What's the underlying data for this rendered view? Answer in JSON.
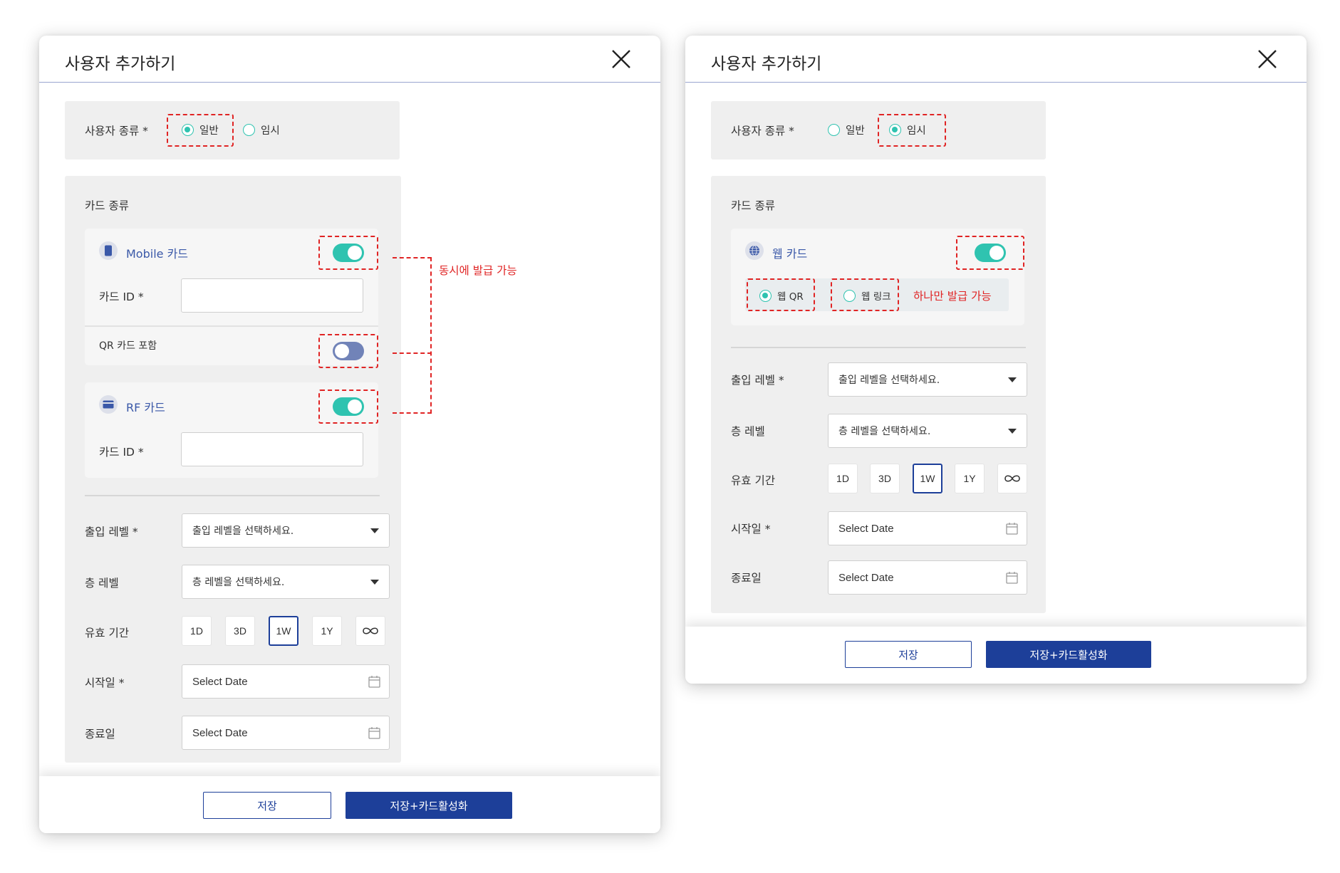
{
  "left_dialog": {
    "title": "사용자 추가하기",
    "user_type": {
      "label": "사용자 종류 *",
      "options": [
        {
          "label": "일반",
          "selected": true
        },
        {
          "label": "임시",
          "selected": false
        }
      ]
    },
    "card_section": {
      "label": "카드 종류",
      "mobile_card": {
        "name": "Mobile 카드",
        "enabled": true,
        "id_label": "카드 ID *",
        "id_value": ""
      },
      "qr_include": {
        "label": "QR 카드 포함",
        "enabled": false
      },
      "rf_card": {
        "name": "RF 카드",
        "enabled": true,
        "id_label": "카드 ID *",
        "id_value": ""
      }
    },
    "annotation": "동시에 발급 가능",
    "access_level": {
      "label": "출입 레벨 *",
      "placeholder": "출입 레벨을 선택하세요."
    },
    "floor_level": {
      "label": "층 레벨",
      "placeholder": "층 레벨을 선택하세요."
    },
    "validity": {
      "label": "유효 기간",
      "options": [
        "1D",
        "3D",
        "1W",
        "1Y",
        "∞"
      ],
      "selected": "1W"
    },
    "start_date": {
      "label": "시작일 *",
      "placeholder": "Select Date"
    },
    "end_date": {
      "label": "종료일",
      "placeholder": "Select Date"
    },
    "save_label": "저장",
    "save_activate_label": "저장+카드활성화"
  },
  "right_dialog": {
    "title": "사용자 추가하기",
    "user_type": {
      "label": "사용자 종류 *",
      "options": [
        {
          "label": "일반",
          "selected": false
        },
        {
          "label": "임시",
          "selected": true
        }
      ]
    },
    "card_section": {
      "label": "카드 종류",
      "web_card": {
        "name": "웹 카드",
        "enabled": true
      },
      "web_options": [
        {
          "label": "웹 QR",
          "selected": true
        },
        {
          "label": "웹 링크",
          "selected": false
        }
      ]
    },
    "annotation": "하나만 발급 가능",
    "access_level": {
      "label": "출입 레벨 *",
      "placeholder": "출입 레벨을 선택하세요."
    },
    "floor_level": {
      "label": "층 레벨",
      "placeholder": "층 레벨을 선택하세요."
    },
    "validity": {
      "label": "유효 기간",
      "options": [
        "1D",
        "3D",
        "1W",
        "1Y",
        "∞"
      ],
      "selected": "1W"
    },
    "start_date": {
      "label": "시작일 *",
      "placeholder": "Select Date"
    },
    "end_date": {
      "label": "종료일",
      "placeholder": "Select Date"
    },
    "save_label": "저장",
    "save_activate_label": "저장+카드활성화"
  },
  "colors": {
    "accent_teal": "#2fc3b0",
    "primary_blue": "#1d3f99",
    "card_name_blue": "#3a58a8",
    "toggle_off": "#7183b8",
    "annotation_red": "#e02424",
    "panel_gray": "#efefef"
  },
  "icons": [
    "close-icon",
    "mobile-phone-icon",
    "credit-card-icon",
    "globe-icon",
    "calendar-icon",
    "infinity-icon",
    "caret-down-icon"
  ]
}
